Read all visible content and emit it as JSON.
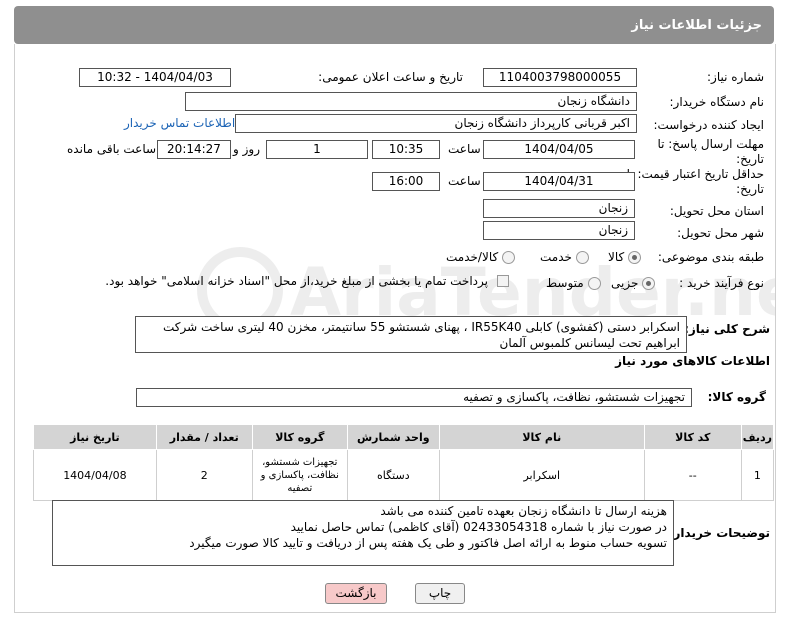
{
  "header": {
    "title": "جزئیات اطلاعات نیاز"
  },
  "form": {
    "need_number_label": "شماره نیاز:",
    "need_number": "1104003798000055",
    "announce_label": "تاریخ و ساعت اعلان عمومی:",
    "announce_value": "1404/04/03 - 10:32",
    "buyer_org_label": "نام دستگاه خریدار:",
    "buyer_org": "دانشگاه زنجان",
    "creator_label": "ایجاد کننده درخواست:",
    "creator": "اکبر قربانی کارپرداز دانشگاه زنجان",
    "contact_link": "اطلاعات تماس خریدار",
    "deadline_label": "مهلت ارسال پاسخ: تا تاریخ:",
    "deadline_date": "1404/04/05",
    "time_label": "ساعت",
    "deadline_time": "10:35",
    "days_value": "1",
    "days_label": "روز و",
    "remaining_time": "20:14:27",
    "remaining_label": "ساعت باقی مانده",
    "validity_label": "حداقل تاریخ اعتبار قیمت: تا تاریخ:",
    "validity_date": "1404/04/31",
    "validity_time": "16:00",
    "province_label": "استان محل تحویل:",
    "province": "زنجان",
    "city_label": "شهر محل تحویل:",
    "city": "زنجان",
    "category_label": "طبقه بندی موضوعی:",
    "category_options": [
      "کالا",
      "خدمت",
      "کالا/خدمت"
    ],
    "category_selected": "کالا",
    "process_label": "نوع فرآیند خرید :",
    "process_options": [
      "جزیی",
      "متوسط"
    ],
    "process_selected": "جزیی",
    "payment_note": "پرداخت تمام یا بخشی از مبلغ خرید،از محل \"اسناد خزانه اسلامی\" خواهد بود.",
    "summary_label": "شرح کلی نیاز:",
    "summary_line1": "اسکرابر دستی (کفشوی) کابلی IR55K40 ، پهنای شستشو 55 سانتیمتر، مخزن 40 لیتری ساخت شرکت",
    "summary_line2": "ابراهیم تحت لیسانس کلمبوس آلمان"
  },
  "goods": {
    "section_title": "اطلاعات کالاهای مورد نیاز",
    "group_label": "گروه کالا:",
    "group_value": "تجهیزات شستشو، نظافت، پاکسازی و تصفیه",
    "columns": [
      "ردیف",
      "کد کالا",
      "نام کالا",
      "واحد شمارش",
      "گروه کالا",
      "تعداد / مقدار",
      "تاریخ نیاز"
    ],
    "rows": [
      {
        "row": "1",
        "code": "--",
        "name": "اسکرابر",
        "unit": "دستگاه",
        "group": "تجهیزات شستشو، نظافت، پاکسازی و تصفیه",
        "qty": "2",
        "date": "1404/04/08"
      }
    ]
  },
  "notes": {
    "label": "توضیحات خریدار:",
    "line1": "هزینه ارسال تا دانشگاه زنجان بعهده تامین کننده می باشد",
    "line2": "در صورت نیاز با شماره 02433054318 (آقای کاظمی) تماس حاصل نمایید",
    "line3": "تسویه حساب منوط به ارائه اصل فاکتور و طی یک هفته پس از دریافت و تایید کالا صورت میگیرد"
  },
  "buttons": {
    "print": "چاپ",
    "back": "بازگشت"
  },
  "colors": {
    "header": "#8f8f8f",
    "link": "#1b63b5",
    "back_button": "#f7c9c9",
    "print_button": "#f0f0f0"
  }
}
